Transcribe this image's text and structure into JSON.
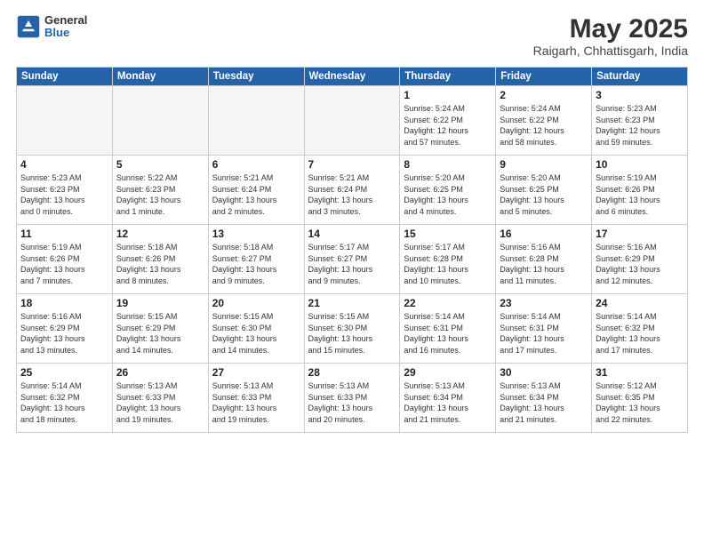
{
  "header": {
    "logo_line1": "General",
    "logo_line2": "Blue",
    "month": "May 2025",
    "location": "Raigarh, Chhattisgarh, India"
  },
  "weekdays": [
    "Sunday",
    "Monday",
    "Tuesday",
    "Wednesday",
    "Thursday",
    "Friday",
    "Saturday"
  ],
  "weeks": [
    [
      {
        "day": "",
        "info": ""
      },
      {
        "day": "",
        "info": ""
      },
      {
        "day": "",
        "info": ""
      },
      {
        "day": "",
        "info": ""
      },
      {
        "day": "1",
        "info": "Sunrise: 5:24 AM\nSunset: 6:22 PM\nDaylight: 12 hours\nand 57 minutes."
      },
      {
        "day": "2",
        "info": "Sunrise: 5:24 AM\nSunset: 6:22 PM\nDaylight: 12 hours\nand 58 minutes."
      },
      {
        "day": "3",
        "info": "Sunrise: 5:23 AM\nSunset: 6:23 PM\nDaylight: 12 hours\nand 59 minutes."
      }
    ],
    [
      {
        "day": "4",
        "info": "Sunrise: 5:23 AM\nSunset: 6:23 PM\nDaylight: 13 hours\nand 0 minutes."
      },
      {
        "day": "5",
        "info": "Sunrise: 5:22 AM\nSunset: 6:23 PM\nDaylight: 13 hours\nand 1 minute."
      },
      {
        "day": "6",
        "info": "Sunrise: 5:21 AM\nSunset: 6:24 PM\nDaylight: 13 hours\nand 2 minutes."
      },
      {
        "day": "7",
        "info": "Sunrise: 5:21 AM\nSunset: 6:24 PM\nDaylight: 13 hours\nand 3 minutes."
      },
      {
        "day": "8",
        "info": "Sunrise: 5:20 AM\nSunset: 6:25 PM\nDaylight: 13 hours\nand 4 minutes."
      },
      {
        "day": "9",
        "info": "Sunrise: 5:20 AM\nSunset: 6:25 PM\nDaylight: 13 hours\nand 5 minutes."
      },
      {
        "day": "10",
        "info": "Sunrise: 5:19 AM\nSunset: 6:26 PM\nDaylight: 13 hours\nand 6 minutes."
      }
    ],
    [
      {
        "day": "11",
        "info": "Sunrise: 5:19 AM\nSunset: 6:26 PM\nDaylight: 13 hours\nand 7 minutes."
      },
      {
        "day": "12",
        "info": "Sunrise: 5:18 AM\nSunset: 6:26 PM\nDaylight: 13 hours\nand 8 minutes."
      },
      {
        "day": "13",
        "info": "Sunrise: 5:18 AM\nSunset: 6:27 PM\nDaylight: 13 hours\nand 9 minutes."
      },
      {
        "day": "14",
        "info": "Sunrise: 5:17 AM\nSunset: 6:27 PM\nDaylight: 13 hours\nand 9 minutes."
      },
      {
        "day": "15",
        "info": "Sunrise: 5:17 AM\nSunset: 6:28 PM\nDaylight: 13 hours\nand 10 minutes."
      },
      {
        "day": "16",
        "info": "Sunrise: 5:16 AM\nSunset: 6:28 PM\nDaylight: 13 hours\nand 11 minutes."
      },
      {
        "day": "17",
        "info": "Sunrise: 5:16 AM\nSunset: 6:29 PM\nDaylight: 13 hours\nand 12 minutes."
      }
    ],
    [
      {
        "day": "18",
        "info": "Sunrise: 5:16 AM\nSunset: 6:29 PM\nDaylight: 13 hours\nand 13 minutes."
      },
      {
        "day": "19",
        "info": "Sunrise: 5:15 AM\nSunset: 6:29 PM\nDaylight: 13 hours\nand 14 minutes."
      },
      {
        "day": "20",
        "info": "Sunrise: 5:15 AM\nSunset: 6:30 PM\nDaylight: 13 hours\nand 14 minutes."
      },
      {
        "day": "21",
        "info": "Sunrise: 5:15 AM\nSunset: 6:30 PM\nDaylight: 13 hours\nand 15 minutes."
      },
      {
        "day": "22",
        "info": "Sunrise: 5:14 AM\nSunset: 6:31 PM\nDaylight: 13 hours\nand 16 minutes."
      },
      {
        "day": "23",
        "info": "Sunrise: 5:14 AM\nSunset: 6:31 PM\nDaylight: 13 hours\nand 17 minutes."
      },
      {
        "day": "24",
        "info": "Sunrise: 5:14 AM\nSunset: 6:32 PM\nDaylight: 13 hours\nand 17 minutes."
      }
    ],
    [
      {
        "day": "25",
        "info": "Sunrise: 5:14 AM\nSunset: 6:32 PM\nDaylight: 13 hours\nand 18 minutes."
      },
      {
        "day": "26",
        "info": "Sunrise: 5:13 AM\nSunset: 6:33 PM\nDaylight: 13 hours\nand 19 minutes."
      },
      {
        "day": "27",
        "info": "Sunrise: 5:13 AM\nSunset: 6:33 PM\nDaylight: 13 hours\nand 19 minutes."
      },
      {
        "day": "28",
        "info": "Sunrise: 5:13 AM\nSunset: 6:33 PM\nDaylight: 13 hours\nand 20 minutes."
      },
      {
        "day": "29",
        "info": "Sunrise: 5:13 AM\nSunset: 6:34 PM\nDaylight: 13 hours\nand 21 minutes."
      },
      {
        "day": "30",
        "info": "Sunrise: 5:13 AM\nSunset: 6:34 PM\nDaylight: 13 hours\nand 21 minutes."
      },
      {
        "day": "31",
        "info": "Sunrise: 5:12 AM\nSunset: 6:35 PM\nDaylight: 13 hours\nand 22 minutes."
      }
    ]
  ]
}
